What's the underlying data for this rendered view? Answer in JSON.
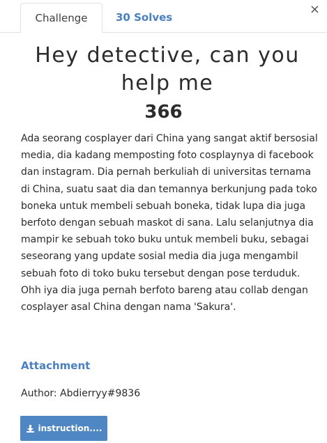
{
  "tabs": {
    "challenge": "Challenge",
    "solves": "30 Solves"
  },
  "close_symbol": "×",
  "challenge": {
    "title": "Hey detective, can you help me",
    "value": "366",
    "description": "Ada seorang cosplayer dari China yang sangat aktif bersosial media, dia kadang memposting foto cosplaynya di facebook dan instagram. Dia pernah berkuliah di universitas ternama di China, suatu saat dia dan temannya berkunjung pada toko boneka untuk membeli sebuah boneka, tidak lupa dia juga berfoto dengan sebuah maskot di sana. Lalu selanjutnya dia mampir ke sebuah toko buku untuk membeli buku, sebagai seseorang yang update sosial media dia juga mengambil sebuah foto di toko buku tersebut dengan pose terduduk. Ohh iya dia juga pernah berfoto bareng atau collab dengan cosplayer asal China dengan nama 'Sakura'.",
    "attachment_heading": "Attachment",
    "author": "Author: Abdierryy#9836",
    "attachment_file_label": "instruction...."
  },
  "icons": {
    "close": "close-icon",
    "download": "download-icon"
  },
  "colors": {
    "accent": "#4a7fc1",
    "button_bg": "#4f87c5",
    "text": "#2b2b2b"
  }
}
